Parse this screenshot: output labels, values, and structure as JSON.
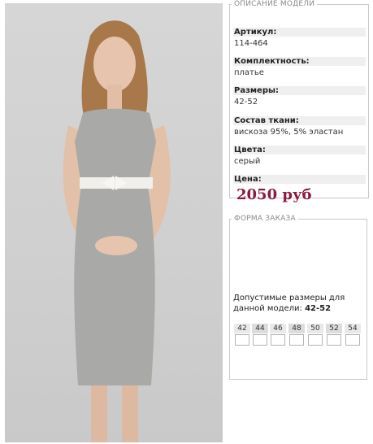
{
  "description": {
    "legend": "ОПИСАНИЕ МОДЕЛИ",
    "fields": [
      {
        "label": "Артикул:",
        "value": "114-464"
      },
      {
        "label": "Комплектность:",
        "value": "платье"
      },
      {
        "label": "Размеры:",
        "value": "42-52"
      },
      {
        "label": "Состав ткани:",
        "value": "вискоза 95%, 5% эластан"
      },
      {
        "label": "Цвета:",
        "value": "серый"
      },
      {
        "label": "Цена:",
        "value": ""
      }
    ],
    "price": "2050 руб",
    "price_color": "#8b1a3c"
  },
  "order": {
    "legend": "ФОРМА ЗАКАЗА",
    "note_prefix": "Допустимые размеры для данной модели:",
    "note_sizes": "42-52",
    "sizes": [
      "42",
      "44",
      "46",
      "48",
      "50",
      "52",
      "54"
    ]
  },
  "photo": {
    "icon": "model-photo",
    "dress_color": "#a9a9a7"
  }
}
